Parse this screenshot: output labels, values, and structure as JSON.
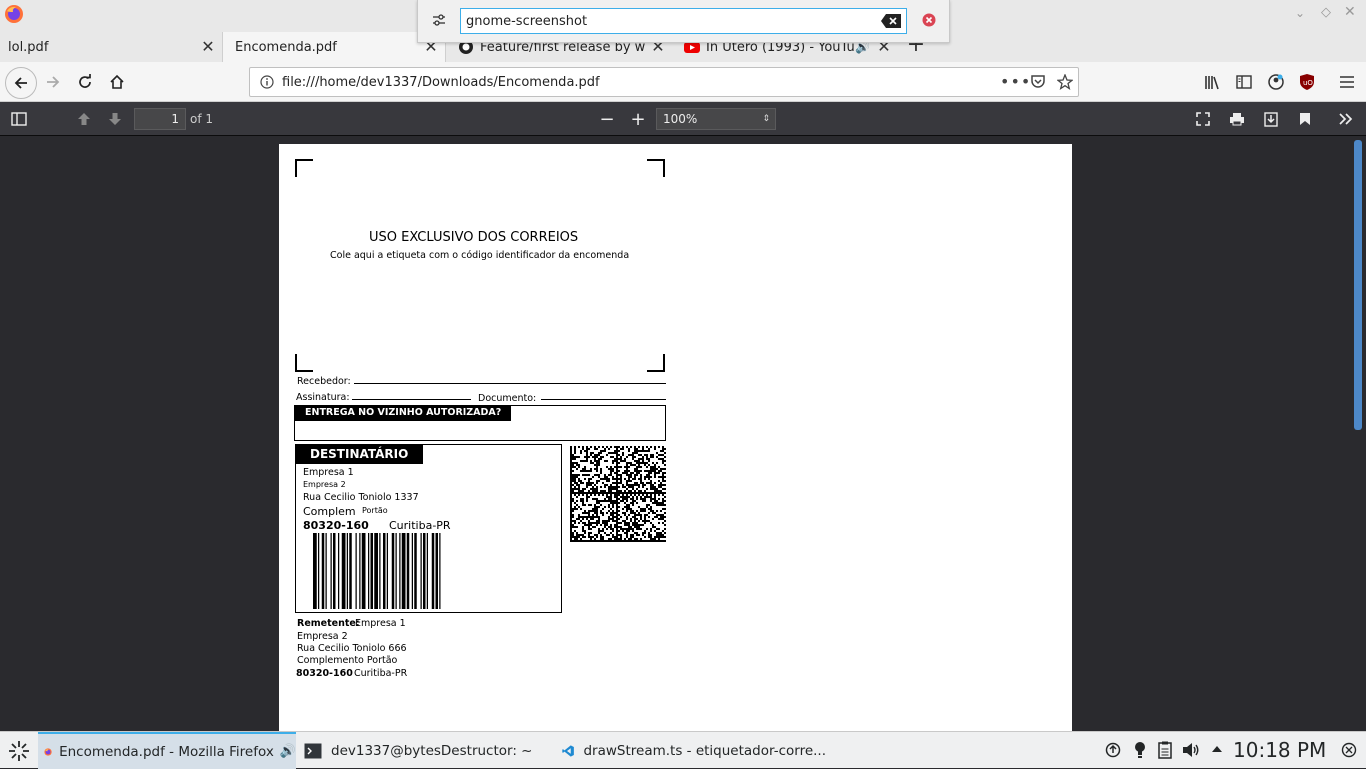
{
  "tabs": [
    {
      "label": "lol.pdf",
      "active": false
    },
    {
      "label": "Encomenda.pdf",
      "active": true
    },
    {
      "label": "Feature/first release by w",
      "active": false,
      "icon": "github-icon"
    },
    {
      "label": "In Utero (1993) - YouTu",
      "active": false,
      "icon": "youtube-icon",
      "audio": true
    }
  ],
  "search": {
    "value": "gnome-screenshot"
  },
  "url": {
    "text": "file:///home/dev1337/Downloads/Encomenda.pdf"
  },
  "pdf_toolbar": {
    "page_value": "1",
    "page_of": "of 1",
    "zoom": "100%"
  },
  "label": {
    "heading": "USO EXCLUSIVO DOS CORREIOS",
    "subheading": "Cole aqui a etiqueta com o código identificador da encomenda",
    "recebedor": "Recebedor:",
    "assinatura": "Assinatura:",
    "documento": "Documento:",
    "vizinho": "ENTREGA NO VIZINHO AUTORIZADA?",
    "destinatario_title": "DESTINATÁRIO",
    "dest_line1": "Empresa 1",
    "dest_line2": "Empresa 2",
    "dest_line3": "Rua Cecilio Toniolo 1337",
    "dest_complem": "Complem",
    "dest_complem_value": "Portão",
    "dest_cep": "80320-160",
    "dest_city": "Curitiba-PR",
    "remetente_label": "Remetente:",
    "rem_line1": "Empresa 1",
    "rem_line2": "Empresa 2",
    "rem_line3": "Rua Cecilio Toniolo 666",
    "rem_line4": "Complemento Portão",
    "rem_cep": "80320-160",
    "rem_city": "Curitiba-PR"
  },
  "taskbar": {
    "items": [
      {
        "label": "Encomenda.pdf - Mozilla Firefox",
        "active": true
      },
      {
        "label": "dev1337@bytesDestructor: ~",
        "active": false
      },
      {
        "label": "drawStream.ts - etiquetador-corre...",
        "active": false
      }
    ],
    "clock": "10:18 PM"
  },
  "colors": {
    "accent": "#3daee9",
    "pdf_toolbar": "#38383d",
    "viewer_bg": "#2a2a2e"
  }
}
